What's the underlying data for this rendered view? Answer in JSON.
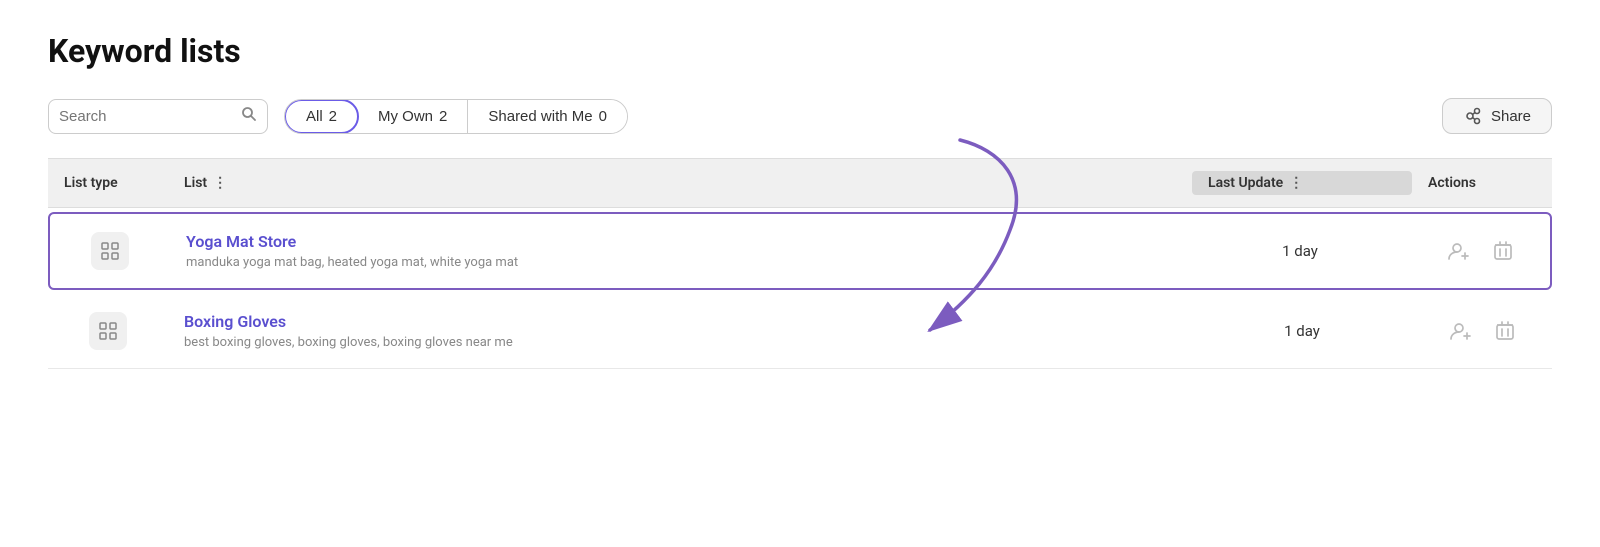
{
  "page": {
    "title": "Keyword lists"
  },
  "toolbar": {
    "search_placeholder": "Search",
    "share_label": "Share"
  },
  "tabs": [
    {
      "id": "all",
      "label": "All",
      "count": "2",
      "active": true
    },
    {
      "id": "my-own",
      "label": "My Own",
      "count": "2",
      "active": false
    },
    {
      "id": "shared-with-me",
      "label": "Shared with Me",
      "count": "0",
      "active": false
    }
  ],
  "table": {
    "columns": [
      {
        "id": "list-type",
        "label": "List type"
      },
      {
        "id": "list",
        "label": "List"
      },
      {
        "id": "last-update",
        "label": "Last Update"
      },
      {
        "id": "actions",
        "label": "Actions"
      }
    ],
    "rows": [
      {
        "id": "yoga-mat-store",
        "name": "Yoga Mat Store",
        "keywords": "manduka yoga mat bag, heated yoga mat, white yoga mat",
        "lastUpdate": "1 day",
        "highlighted": true
      },
      {
        "id": "boxing-gloves",
        "name": "Boxing Gloves",
        "keywords": "best boxing gloves, boxing gloves, boxing gloves near me",
        "lastUpdate": "1 day",
        "highlighted": false
      }
    ]
  }
}
